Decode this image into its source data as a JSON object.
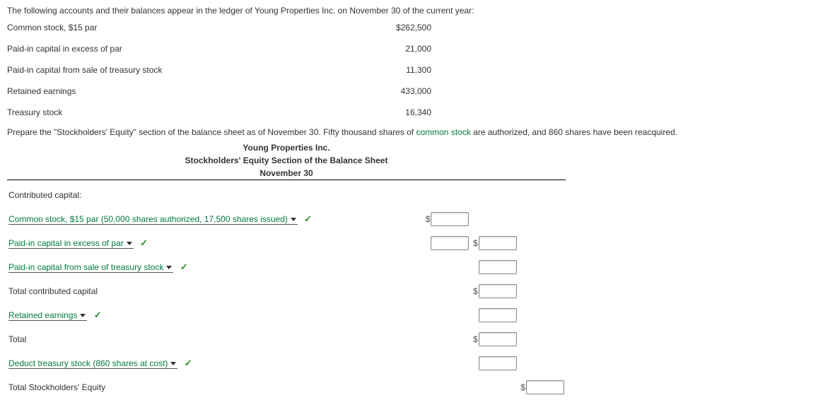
{
  "intro": "The following accounts and their balances appear in the ledger of Young Properties Inc. on November 30 of the current year:",
  "ledger": [
    {
      "name": "Common stock, $15 par",
      "value": "$262,500"
    },
    {
      "name": "Paid-in capital in excess of par",
      "value": "21,000"
    },
    {
      "name": "Paid-in capital from sale of treasury stock",
      "value": "11,300"
    },
    {
      "name": "Retained earnings",
      "value": "433,000"
    },
    {
      "name": "Treasury stock",
      "value": "16,340"
    }
  ],
  "instruction_pre": "Prepare the \"Stockholders' Equity\" section of the balance sheet as of November 30. Fifty thousand shares of ",
  "instruction_link": "common stock",
  "instruction_post": " are authorized, and 860 shares have been reacquired.",
  "title1": "Young Properties Inc.",
  "title2": "Stockholders' Equity Section of the Balance Sheet",
  "title3": "November 30",
  "rows": {
    "contrib": "Contributed capital:",
    "dd_common": "Common stock, $15 par (50,000 shares authorized, 17,500 shares issued)",
    "dd_excess": "Paid-in capital in excess of par",
    "dd_treas_sale": "Paid-in capital from sale of treasury stock",
    "total_contrib": "Total contributed capital",
    "dd_retained": "Retained earnings",
    "total": "Total",
    "dd_deduct": "Deduct treasury stock (860 shares at cost)",
    "total_se": "Total Stockholders' Equity"
  },
  "glyph": {
    "dollar": "$",
    "check": "✓"
  }
}
